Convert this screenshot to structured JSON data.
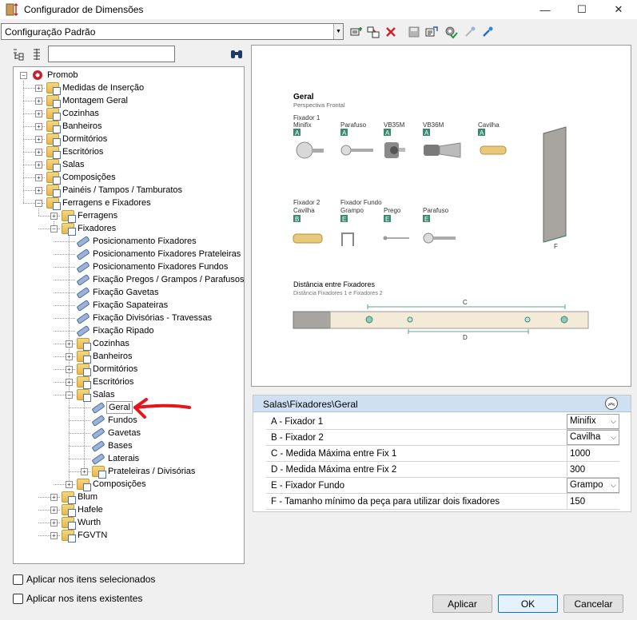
{
  "window": {
    "title": "Configurador de Dimensões",
    "minimize": "—",
    "maximize": "☐",
    "close": "✕"
  },
  "toolbar": {
    "config_value": "Configuração Padrão"
  },
  "tree": {
    "search_value": "",
    "nodes": [
      {
        "label": "Promob",
        "level": 0,
        "icon": "promob-logo-icon",
        "expander": "minus"
      },
      {
        "label": "Medidas de Inserção",
        "level": 1,
        "icon": "folder-icon",
        "expander": "plus"
      },
      {
        "label": "Montagem Geral",
        "level": 1,
        "icon": "folder-icon",
        "expander": "plus"
      },
      {
        "label": "Cozinhas",
        "level": 1,
        "icon": "folder-icon",
        "expander": "plus"
      },
      {
        "label": "Banheiros",
        "level": 1,
        "icon": "folder-icon",
        "expander": "plus"
      },
      {
        "label": "Dormitórios",
        "level": 1,
        "icon": "folder-icon",
        "expander": "plus"
      },
      {
        "label": "Escritórios",
        "level": 1,
        "icon": "folder-icon",
        "expander": "plus"
      },
      {
        "label": "Salas",
        "level": 1,
        "icon": "folder-icon",
        "expander": "plus"
      },
      {
        "label": "Composições",
        "level": 1,
        "icon": "folder-icon",
        "expander": "plus"
      },
      {
        "label": "Painéis / Tampos / Tamburatos",
        "level": 1,
        "icon": "folder-icon",
        "expander": "plus"
      },
      {
        "label": "Ferragens e Fixadores",
        "level": 1,
        "icon": "folder-icon",
        "expander": "minus"
      },
      {
        "label": "Ferragens",
        "level": 2,
        "icon": "folder-icon",
        "expander": "plus"
      },
      {
        "label": "Fixadores",
        "level": 2,
        "icon": "folder-icon",
        "expander": "minus"
      },
      {
        "label": "Posicionamento Fixadores",
        "level": 3,
        "icon": "parameter-icon",
        "expander": ""
      },
      {
        "label": "Posicionamento Fixadores Prateleiras",
        "level": 3,
        "icon": "parameter-icon",
        "expander": ""
      },
      {
        "label": "Posicionamento Fixadores Fundos",
        "level": 3,
        "icon": "parameter-icon",
        "expander": ""
      },
      {
        "label": "Fixação Pregos / Grampos / Parafusos",
        "level": 3,
        "icon": "parameter-icon",
        "expander": ""
      },
      {
        "label": "Fixação Gavetas",
        "level": 3,
        "icon": "parameter-icon",
        "expander": ""
      },
      {
        "label": "Fixação Sapateiras",
        "level": 3,
        "icon": "parameter-icon",
        "expander": ""
      },
      {
        "label": "Fixação Divisórias - Travessas",
        "level": 3,
        "icon": "parameter-icon",
        "expander": ""
      },
      {
        "label": "Fixação Ripado",
        "level": 3,
        "icon": "parameter-icon",
        "expander": ""
      },
      {
        "label": "Cozinhas",
        "level": 3,
        "icon": "folder-icon",
        "expander": "plus"
      },
      {
        "label": "Banheiros",
        "level": 3,
        "icon": "folder-icon",
        "expander": "plus"
      },
      {
        "label": "Dormitórios",
        "level": 3,
        "icon": "folder-icon",
        "expander": "plus"
      },
      {
        "label": "Escritórios",
        "level": 3,
        "icon": "folder-icon",
        "expander": "plus"
      },
      {
        "label": "Salas",
        "level": 3,
        "icon": "folder-icon",
        "expander": "minus"
      },
      {
        "label": "Geral",
        "level": 4,
        "icon": "parameter-icon",
        "expander": "",
        "selected": true
      },
      {
        "label": "Fundos",
        "level": 4,
        "icon": "parameter-icon",
        "expander": ""
      },
      {
        "label": "Gavetas",
        "level": 4,
        "icon": "parameter-icon",
        "expander": ""
      },
      {
        "label": "Bases",
        "level": 4,
        "icon": "parameter-icon",
        "expander": ""
      },
      {
        "label": "Laterais",
        "level": 4,
        "icon": "parameter-icon",
        "expander": ""
      },
      {
        "label": "Prateleiras / Divisórias",
        "level": 4,
        "icon": "folder-icon",
        "expander": "plus"
      },
      {
        "label": "Composições",
        "level": 3,
        "icon": "folder-icon",
        "expander": "plus"
      },
      {
        "label": "Blum",
        "level": 2,
        "icon": "folder-icon",
        "expander": "plus"
      },
      {
        "label": "Hafele",
        "level": 2,
        "icon": "folder-icon",
        "expander": "plus"
      },
      {
        "label": "Wurth",
        "level": 2,
        "icon": "folder-icon",
        "expander": "plus"
      },
      {
        "label": "FGVTN",
        "level": 2,
        "icon": "folder-icon",
        "expander": "plus"
      }
    ]
  },
  "illustration": {
    "title": "Geral",
    "subtitle": "Perspectiva Frontal",
    "fix1_group": "Fixador 1",
    "fix1_items": [
      {
        "name": "Minifix",
        "badge": "A"
      },
      {
        "name": "Parafuso",
        "badge": "A"
      },
      {
        "name": "VB35M",
        "badge": "A"
      },
      {
        "name": "VB36M",
        "badge": "A"
      },
      {
        "name": "Cavilha",
        "badge": "A"
      }
    ],
    "fix2_group": "Fixador 2",
    "fix2_item": {
      "name": "Cavilha",
      "badge": "B"
    },
    "fundo_group": "Fixador Fundo",
    "fundo_items": [
      {
        "name": "Grampo",
        "badge": "E"
      },
      {
        "name": "Prego",
        "badge": "E"
      },
      {
        "name": "Parafuso",
        "badge": "E"
      }
    ],
    "panel_label": "F",
    "distance_title": "Distância entre Fixadores",
    "distance_subtitle": "Distância Fixadores 1 e Fixadores 2",
    "dim_c": "C",
    "dim_d": "D",
    "badge_color": "#3a8a6e"
  },
  "properties": {
    "header": "Salas\\Fixadores\\Geral",
    "rows": [
      {
        "label": "A - Fixador 1",
        "value": "Minifix",
        "dropdown": true
      },
      {
        "label": "B - Fixador 2",
        "value": "Cavilha",
        "dropdown": true
      },
      {
        "label": "C - Medida Máxima entre Fix 1",
        "value": "1000",
        "dropdown": false
      },
      {
        "label": "D - Medida Máxima entre Fix 2",
        "value": "300",
        "dropdown": false
      },
      {
        "label": "E - Fixador Fundo",
        "value": "Grampo",
        "dropdown": true
      },
      {
        "label": "F - Tamanho mínimo da peça para utilizar dois fixadores",
        "value": "150",
        "dropdown": false
      }
    ]
  },
  "options": {
    "apply_selected": "Aplicar nos itens selecionados",
    "apply_existing": "Aplicar nos itens existentes"
  },
  "buttons": {
    "apply": "Aplicar",
    "ok": "OK",
    "cancel": "Cancelar"
  },
  "colors": {
    "annotation_arrow": "#e8141c",
    "header_bg": "#cfe0f3",
    "accent": "#0078d7"
  }
}
